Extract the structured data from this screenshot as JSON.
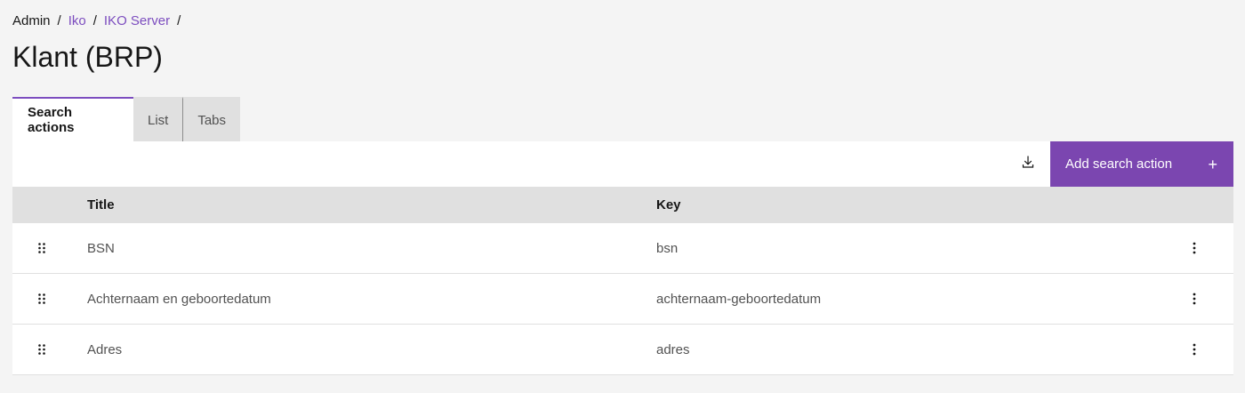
{
  "breadcrumb": {
    "items": [
      {
        "label": "Admin",
        "link": false
      },
      {
        "label": "Iko",
        "link": true
      },
      {
        "label": "IKO Server",
        "link": true
      }
    ],
    "separator": "/"
  },
  "page": {
    "title": "Klant (BRP)"
  },
  "tabs": [
    {
      "label": "Search actions",
      "active": true
    },
    {
      "label": "List",
      "active": false
    },
    {
      "label": "Tabs",
      "active": false
    }
  ],
  "toolbar": {
    "download_icon": "download-icon",
    "add_label": "Add search action",
    "add_icon": "+"
  },
  "table": {
    "columns": [
      "Title",
      "Key"
    ],
    "rows": [
      {
        "title": "BSN",
        "key": "bsn"
      },
      {
        "title": "Achternaam en geboortedatum",
        "key": "achternaam-geboortedatum"
      },
      {
        "title": "Adres",
        "key": "adres"
      }
    ]
  },
  "colors": {
    "accent": "#7b46b0",
    "link": "#7c4dbf",
    "background": "#f4f4f4"
  }
}
